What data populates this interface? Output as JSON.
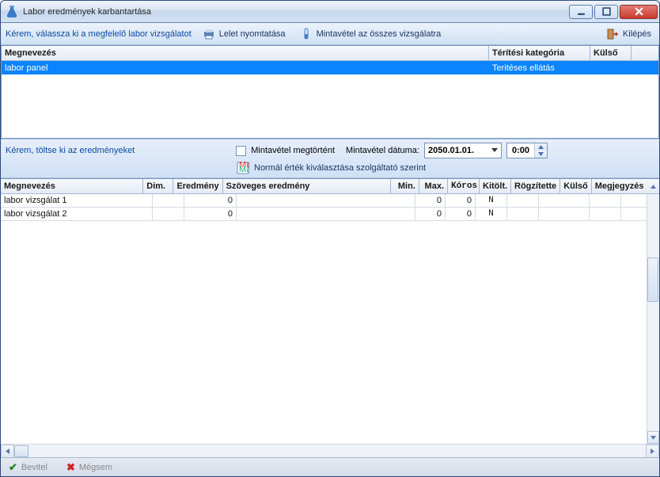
{
  "window": {
    "title": "Labor eredmények karbantartása"
  },
  "toolbar": {
    "prompt": "Kérem, válassza ki a megfelelő labor vizsgálatot",
    "print_label": "Lelet nyomtatása",
    "sample_all_label": "Mintavétel az összes vizsgálatra",
    "exit_label": "Kilépés"
  },
  "top_grid": {
    "headers": {
      "name": "Megnevezés",
      "category": "Térítési kategória",
      "external": "Külső"
    },
    "rows": [
      {
        "name": "labor panel",
        "category": "Teritéses ellátás",
        "external": ""
      }
    ]
  },
  "mid": {
    "prompt": "Kérem, töltse ki az eredményeket",
    "sample_done_label": "Mintavétel megtörtént",
    "sample_date_label": "Mintavétel dátuma:",
    "date_value": "2050.01.01.",
    "time_value": "0:00",
    "normal_values_label": "Normál érték kiválasztása szolgáltató szerint"
  },
  "bottom_grid": {
    "headers": {
      "name": "Megnevezés",
      "dim": "Dim.",
      "result": "Eredmény",
      "text": "Szöveges eredmény",
      "min": "Min.",
      "max": "Max.",
      "koros": "Kóros",
      "kitolt": "Kitölt.",
      "rogz": "Rögzítette",
      "kulso": "Külső",
      "megj": "Megjegyzés"
    },
    "rows": [
      {
        "name": "labor vizsgálat 1",
        "dim": "",
        "result": "0",
        "text": "",
        "min": "0",
        "max": "0",
        "koros": "N",
        "kitolt": "",
        "rogz": "",
        "kulso": "",
        "megj": ""
      },
      {
        "name": "labor vizsgálat 2",
        "dim": "",
        "result": "0",
        "text": "",
        "min": "0",
        "max": "0",
        "koros": "N",
        "kitolt": "",
        "rogz": "",
        "kulso": "",
        "megj": ""
      }
    ]
  },
  "footer": {
    "ok_label": "Bevitel",
    "cancel_label": "Mégsem"
  }
}
